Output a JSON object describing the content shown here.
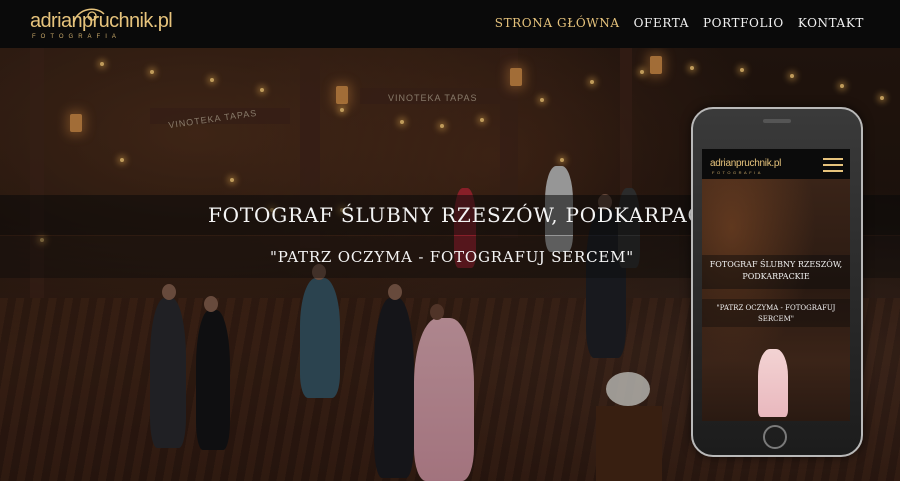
{
  "header": {
    "logo_text": "adrianpruchnik.pl",
    "logo_subtitle": "FOTOGRAFIA",
    "nav": [
      {
        "label": "STRONA GŁÓWNA",
        "active": true
      },
      {
        "label": "OFERTA",
        "active": false
      },
      {
        "label": "PORTFOLIO",
        "active": false
      },
      {
        "label": "KONTAKT",
        "active": false
      }
    ]
  },
  "hero": {
    "title": "FOTOGRAF ŚLUBNY RZESZÓW, PODKARPACKIE",
    "tagline": "\"PATRZ OCZYMA - FOTOGRAFUJ SERCEM\"",
    "signs": [
      "VINOTEKA TAPAS",
      "VINOTEKA TAPAS"
    ]
  },
  "phone": {
    "logo_text": "adrianpruchnik.pl",
    "logo_subtitle": "FOTOGRAFIA",
    "title_line1": "FOTOGRAF ŚLUBNY RZESZÓW,",
    "title_line2": "PODKARPACKIE",
    "tagline_line1": "\"PATRZ OCZYMA - FOTOGRAFUJ",
    "tagline_line2": "SERCEM\""
  },
  "colors": {
    "accent": "#e6c37c",
    "header_bg": "#0a0a0a",
    "text": "#f4f4f4"
  },
  "icons": [
    "camera-logo-icon",
    "hamburger-menu-icon"
  ]
}
